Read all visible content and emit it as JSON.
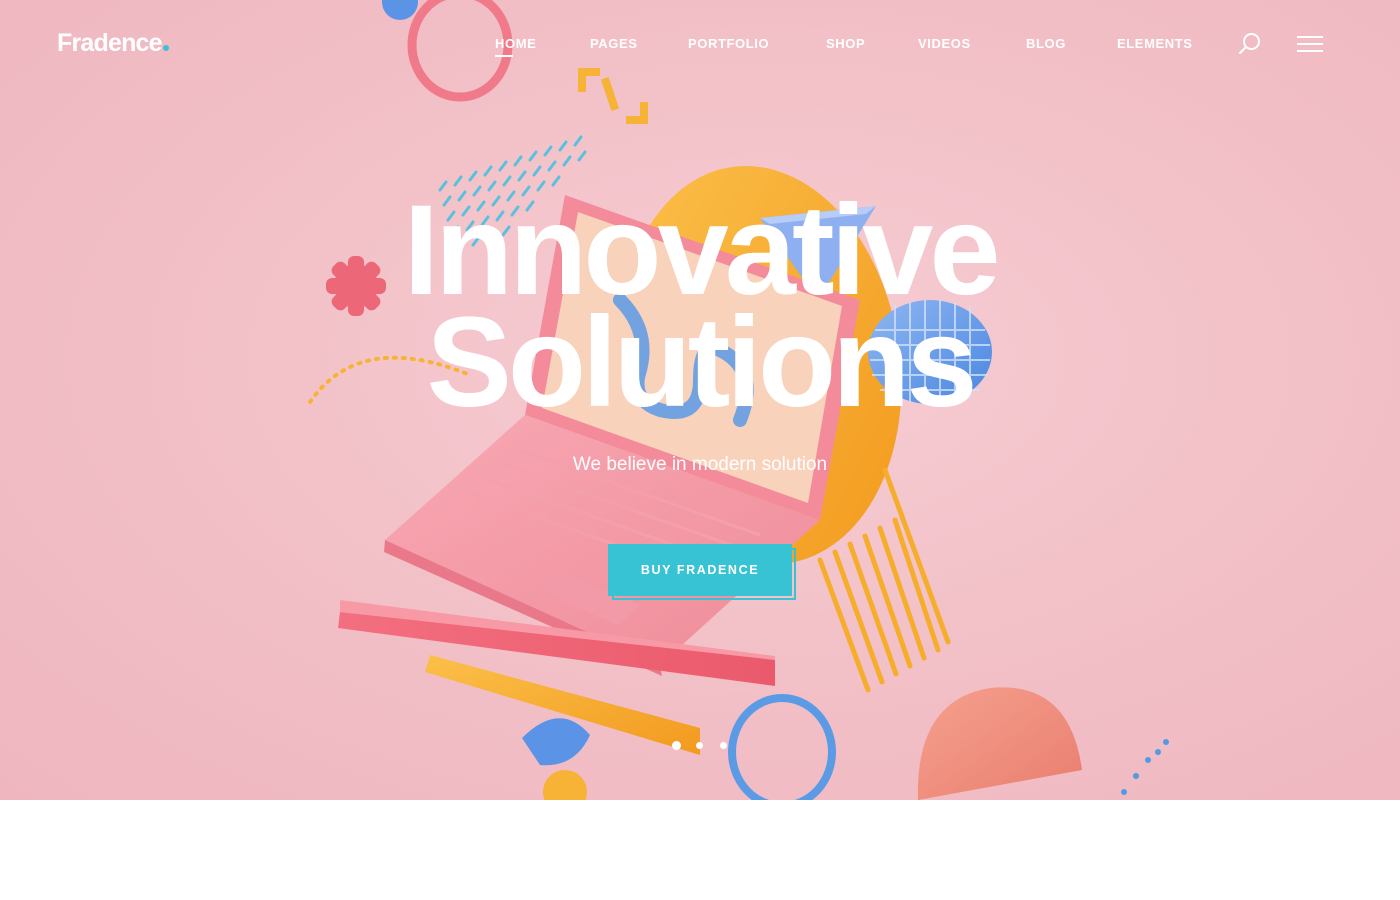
{
  "brand": {
    "name": "Fradence",
    "dot_color": "#38c3d4"
  },
  "nav": {
    "items": [
      {
        "label": "HOME",
        "active": true
      },
      {
        "label": "PAGES",
        "active": false
      },
      {
        "label": "PORTFOLIO",
        "active": false
      },
      {
        "label": "SHOP",
        "active": false
      },
      {
        "label": "VIDEOS",
        "active": false
      },
      {
        "label": "BLOG",
        "active": false
      },
      {
        "label": "ELEMENTS",
        "active": false
      }
    ],
    "search_icon": "search-icon",
    "menu_icon": "hamburger-icon"
  },
  "hero": {
    "title_line1": "Innovative",
    "title_line2": "Solutions",
    "subtitle": "We believe in modern solution",
    "cta_label": "BUY FRADENCE",
    "cta_color": "#38c3d4",
    "background_color": "#f2c0c7",
    "slider": {
      "count": 3,
      "active_index": 0
    }
  }
}
